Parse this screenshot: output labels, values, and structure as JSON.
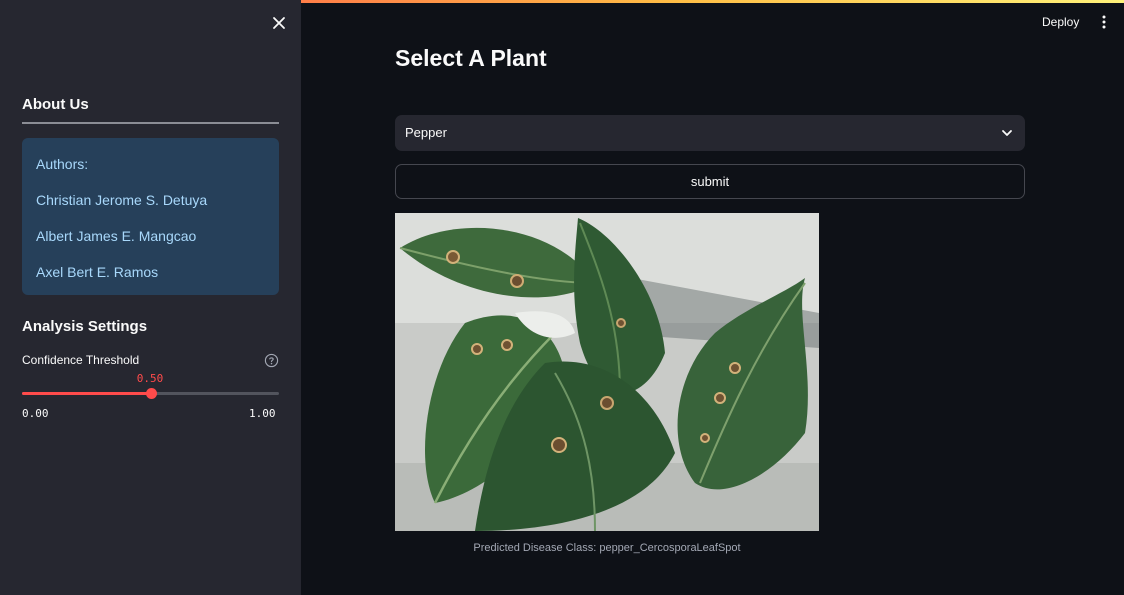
{
  "sidebar": {
    "about_heading": "About Us",
    "authors": {
      "label": "Authors:",
      "names": [
        "Christian Jerome S. Detuya",
        "Albert James E. Mangcao",
        "Axel Bert E. Ramos"
      ]
    },
    "analysis_heading": "Analysis Settings",
    "slider": {
      "label": "Confidence Threshold",
      "value": 0.5,
      "value_display": "0.50",
      "min_display": "0.00",
      "max_display": "1.00",
      "accent_color": "#ff4b4b"
    },
    "icons": {
      "close": "close-icon",
      "help": "help-icon"
    }
  },
  "header": {
    "deploy_label": "Deploy",
    "menu_icon": "more-vertical-icon"
  },
  "main": {
    "title": "Select A Plant",
    "plant_select": {
      "selected": "Pepper"
    },
    "submit_label": "submit",
    "image_caption": "Predicted Disease Class: pepper_CercosporaLeafSpot"
  },
  "colors": {
    "background": "#0e1117",
    "sidebar": "#262730",
    "authors_box": "#26405a",
    "authors_text": "#a8d8fb",
    "accent": "#ff4b4b"
  }
}
